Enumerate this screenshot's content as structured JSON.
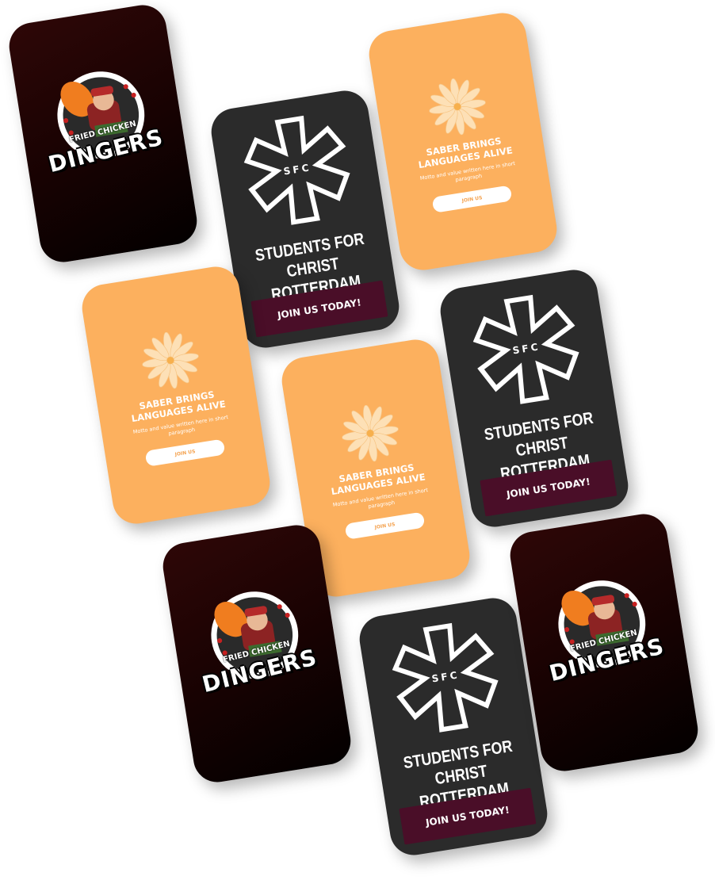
{
  "colors": {
    "dingers_bg": "#1a0303",
    "sfc_bg": "#2b2b2b",
    "sfc_button": "#4a0e28",
    "saber_bg": "#fcb05e",
    "saber_button_text": "#f4a24f"
  },
  "dingers": {
    "logo_icon": "fried-chicken-mascot-logo",
    "small_text": "FRIED CHICKEN",
    "big_text": "DINGERS"
  },
  "sfc": {
    "logo_icon": "sfc-star-logo",
    "title_line1": "STUDENTS FOR CHRIST",
    "title_line2": "ROTTERDAM",
    "button_label": "JOIN US TODAY!"
  },
  "saber": {
    "logo_icon": "flower-icon",
    "title_line1": "SABER BRINGS",
    "title_line2": "LANGUAGES ALIVE",
    "description": "Motto and value written here in short paragraph",
    "button_label": "JOIN US"
  }
}
